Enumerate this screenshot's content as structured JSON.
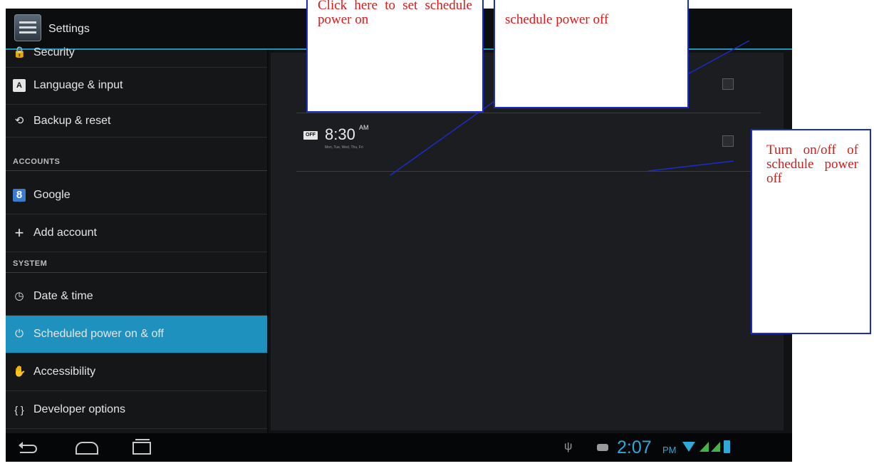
{
  "app": {
    "title": "Settings"
  },
  "settings_menu": [
    {
      "type": "item",
      "label": "Security",
      "icon": "lock-icon"
    },
    {
      "type": "item",
      "label": "Language & input",
      "icon": "keyboard-letter-icon"
    },
    {
      "type": "item",
      "label": "Backup & reset",
      "icon": "backup-restore-icon"
    },
    {
      "type": "header",
      "label": "ACCOUNTS"
    },
    {
      "type": "item",
      "label": "Google",
      "icon": "google-icon"
    },
    {
      "type": "item",
      "label": "Add account",
      "icon": "plus-icon"
    },
    {
      "type": "header",
      "label": "SYSTEM"
    },
    {
      "type": "item",
      "label": "Date & time",
      "icon": "clock-icon"
    },
    {
      "type": "item",
      "label": "Scheduled power on & off",
      "icon": "power-clock-icon",
      "selected": true
    },
    {
      "type": "item",
      "label": "Accessibility",
      "icon": "hand-icon"
    },
    {
      "type": "item",
      "label": "Developer options",
      "icon": "braces-icon"
    }
  ],
  "schedules": {
    "power_off": {
      "badge": "OFF",
      "time": "8:30",
      "ampm": "AM",
      "days": "Mon, Tue, Wed, Thu, Fri",
      "enabled": false
    }
  },
  "status_bar": {
    "time": "2:07",
    "ampm": "PM",
    "icons": [
      "usb-icon",
      "chat-icon",
      "wifi-icon",
      "signal-icon",
      "battery-icon"
    ]
  },
  "nav_bar": {
    "buttons": [
      "back-button",
      "home-button",
      "recent-apps-button"
    ]
  },
  "annotations": {
    "power_on": "Click here to set schedule power on",
    "power_off": "schedule power off",
    "toggle": "Turn on/off of schedule power off"
  },
  "colors": {
    "accent": "#1f91bf",
    "status_blue": "#2ea9d8",
    "callout_border": "#1c2cc8",
    "callout_text": "#e01818"
  }
}
